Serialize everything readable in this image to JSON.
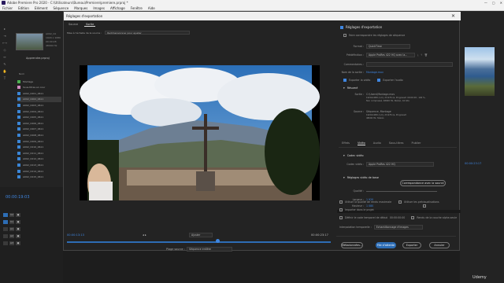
{
  "app": {
    "title": "Adobe Premiere Pro 2020 - C:\\Utilisateurs\\Bureau\\Premiere\\premiere.prproj *",
    "window_buttons": [
      "—",
      "▢",
      "✕"
    ]
  },
  "menu": [
    "Fichier",
    "Edition",
    "Elément",
    "Séquence",
    "Marques",
    "Images",
    "Affichage",
    "Fenêtre",
    "Aide"
  ],
  "project": {
    "source_meta": [
      "A002_C0",
      "1920 x 1080",
      "00:00:28",
      "48000 Hz"
    ],
    "project_label": "Apprendre.prproj",
    "list_header": "Nom",
    "items": [
      "Montage",
      "Sous-titres en cour",
      "A002_C001_0611",
      "A002_C002_0611",
      "A002_C003_0611",
      "A002_C004_0611",
      "A002_C005_0611",
      "A002_C006_0611",
      "A002_C007_0611",
      "A002_C008_0611",
      "A002_C009_0611",
      "A002_C010_0611",
      "A002_C011_0611",
      "A002_C012_0611",
      "A002_C013_0611",
      "A002_C014_0611",
      "A002_C015_0611"
    ]
  },
  "timeline_left": {
    "timecode": "00:00:19:03",
    "tracks": [
      "V2",
      "V1",
      "A1",
      "A2",
      "A3"
    ]
  },
  "dialog": {
    "title": "Réglages d'exportation",
    "close": "✕",
    "tabs": [
      "Source",
      "Sortie"
    ],
    "crop_label": "Mise à l'échelle de la source :",
    "crop_value": "Redimensionner pour ajuster",
    "scrub": {
      "in_time": "00:00:13:13",
      "out_time": "00:00:23:17",
      "fit_label": "Ajuster",
      "range_label": "Plage source :",
      "range_value": "Séquence entière"
    },
    "settings": {
      "header": "Réglages d'exportation",
      "match_seq": "Faire correspondre les réglages de séquence",
      "format_label": "Format :",
      "format_value": "QuickTime",
      "preset_label": "Prédéfinition :",
      "preset_value": "Apple ProRes 422 HQ avec la...",
      "comments_label": "Commentaires :",
      "output_label": "Nom de la sortie :",
      "output_value": "Montage.mov",
      "export_video": "Exporter la vidéo",
      "export_audio": "Exporter l'audio",
      "summary_header": "Résumé",
      "output_summary_label": "Sortie :",
      "output_summary": "C:\\Users\\Montage.mov",
      "output_summary_2": "1920x1080 (1,0), 23,976 i/s, Progressif, 00:00:28 ; 100 %,",
      "output_summary_3": "Non compressé, 48000 Hz, Stéréo, 16 bits",
      "source_summary_label": "Source :",
      "source_summary": "Séquence, Montage",
      "source_summary_2": "1920x1080 (1,0), 23,976 i/s, Progressif,",
      "source_summary_3": "48000 Hz, Stéréo"
    },
    "format_tabs": [
      "Effets",
      "Vidéo",
      "Audio",
      "Sous-titres",
      "Publier"
    ],
    "video_codec": {
      "header": "Codec vidéo",
      "codec_label": "Codec vidéo :",
      "codec_value": "Apple ProRes 422 HQ"
    },
    "basic_video": {
      "header": "Réglages vidéo de base",
      "match_button": "Correspondance avec la source",
      "quality_label": "Qualité :",
      "width_label": "Largeur :",
      "width_value": "1 920",
      "height_label": "Hauteur :",
      "height_value": "1 080"
    },
    "options": [
      "Utiliser la qualité de rendu maximale",
      "Utiliser les prévisualisations",
      "Importer dans le projet",
      "Définir le code temporel de début",
      "Rendu de la couche alpha seule"
    ],
    "start_tc": "00:00:00:00",
    "interp_label": "Interpolation temporelle :",
    "interp_value": "Echantillonnage d'images",
    "buttons": [
      "Métadonnées...",
      "File d'attente",
      "Exporter",
      "Annuler"
    ]
  },
  "right_program": {
    "timecode": "00:00:23:17"
  },
  "watermark": "Udemy"
}
